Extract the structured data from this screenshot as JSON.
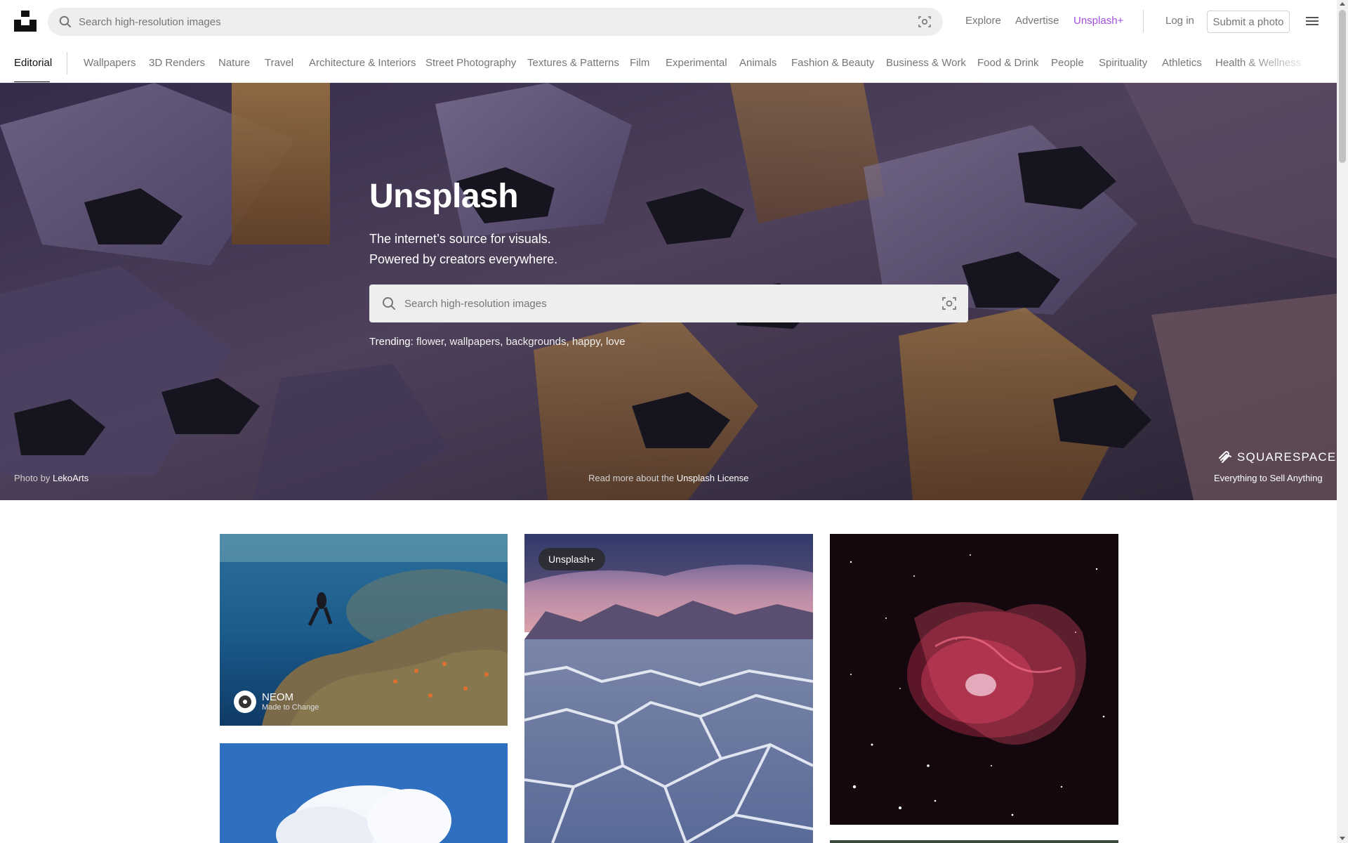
{
  "header": {
    "search_placeholder": "Search high-resolution images",
    "nav": {
      "explore": "Explore",
      "advertise": "Advertise",
      "unsplash_plus": "Unsplash+",
      "login": "Log in",
      "submit": "Submit a photo"
    },
    "icons": {
      "logo": "unsplash-logo",
      "search": "search-icon",
      "visual_search": "visual-search-icon",
      "menu": "hamburger-menu-icon"
    },
    "accent_color": "#a14fe0"
  },
  "tabs": {
    "items": [
      "Editorial",
      "Wallpapers",
      "3D Renders",
      "Nature",
      "Travel",
      "Architecture & Interiors",
      "Street Photography",
      "Textures & Patterns",
      "Film",
      "Experimental",
      "Animals",
      "Fashion & Beauty",
      "Business & Work",
      "Food & Drink",
      "People",
      "Spirituality",
      "Athletics",
      "Health & Wellness"
    ],
    "active": "Editorial"
  },
  "hero": {
    "title": "Unsplash",
    "subtitle_line1": "The internet’s source for visuals.",
    "subtitle_line2": "Powered by creators everywhere.",
    "search_placeholder": "Search high-resolution images",
    "trending_label": "Trending:",
    "trending": [
      "flower",
      "wallpapers",
      "backgrounds",
      "happy",
      "love"
    ],
    "credit_prefix": "Photo",
    "credit_by": "by",
    "credit_author": "LekoArts",
    "license_prefix": "Read more about the",
    "license_link": "Unsplash License",
    "sponsor_name": "SQUARESPACE",
    "sponsor_tagline": "Everything to Sell Anything"
  },
  "grid": {
    "photo1_sponsor": "NEOM",
    "photo1_sponsor_sub": "Made to Change",
    "photo2_badge": "Unsplash+"
  }
}
